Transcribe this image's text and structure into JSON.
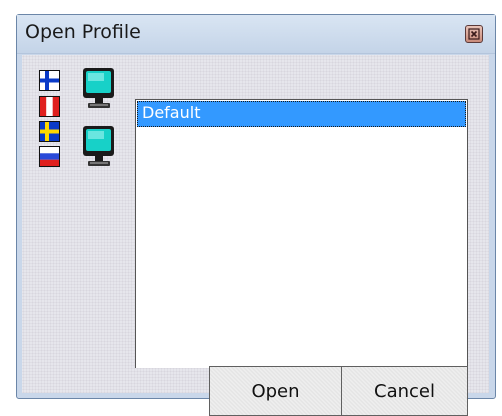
{
  "window": {
    "title": "Open Profile",
    "close_icon": "close-icon"
  },
  "language_flags": [
    {
      "name": "finland-flag-icon"
    },
    {
      "name": "italy-flag-icon"
    },
    {
      "name": "sweden-flag-icon"
    },
    {
      "name": "russia-flag-icon"
    }
  ],
  "display_icons": [
    "monitor-icon",
    "monitor-icon"
  ],
  "profile_list": {
    "items": [
      {
        "label": "Default",
        "selected": true
      }
    ]
  },
  "buttons": {
    "open_label": "Open",
    "cancel_label": "Cancel"
  },
  "colors": {
    "window_frame": "#c9d7ea",
    "selection": "#3399ff",
    "close_button": "#c98b7a"
  }
}
